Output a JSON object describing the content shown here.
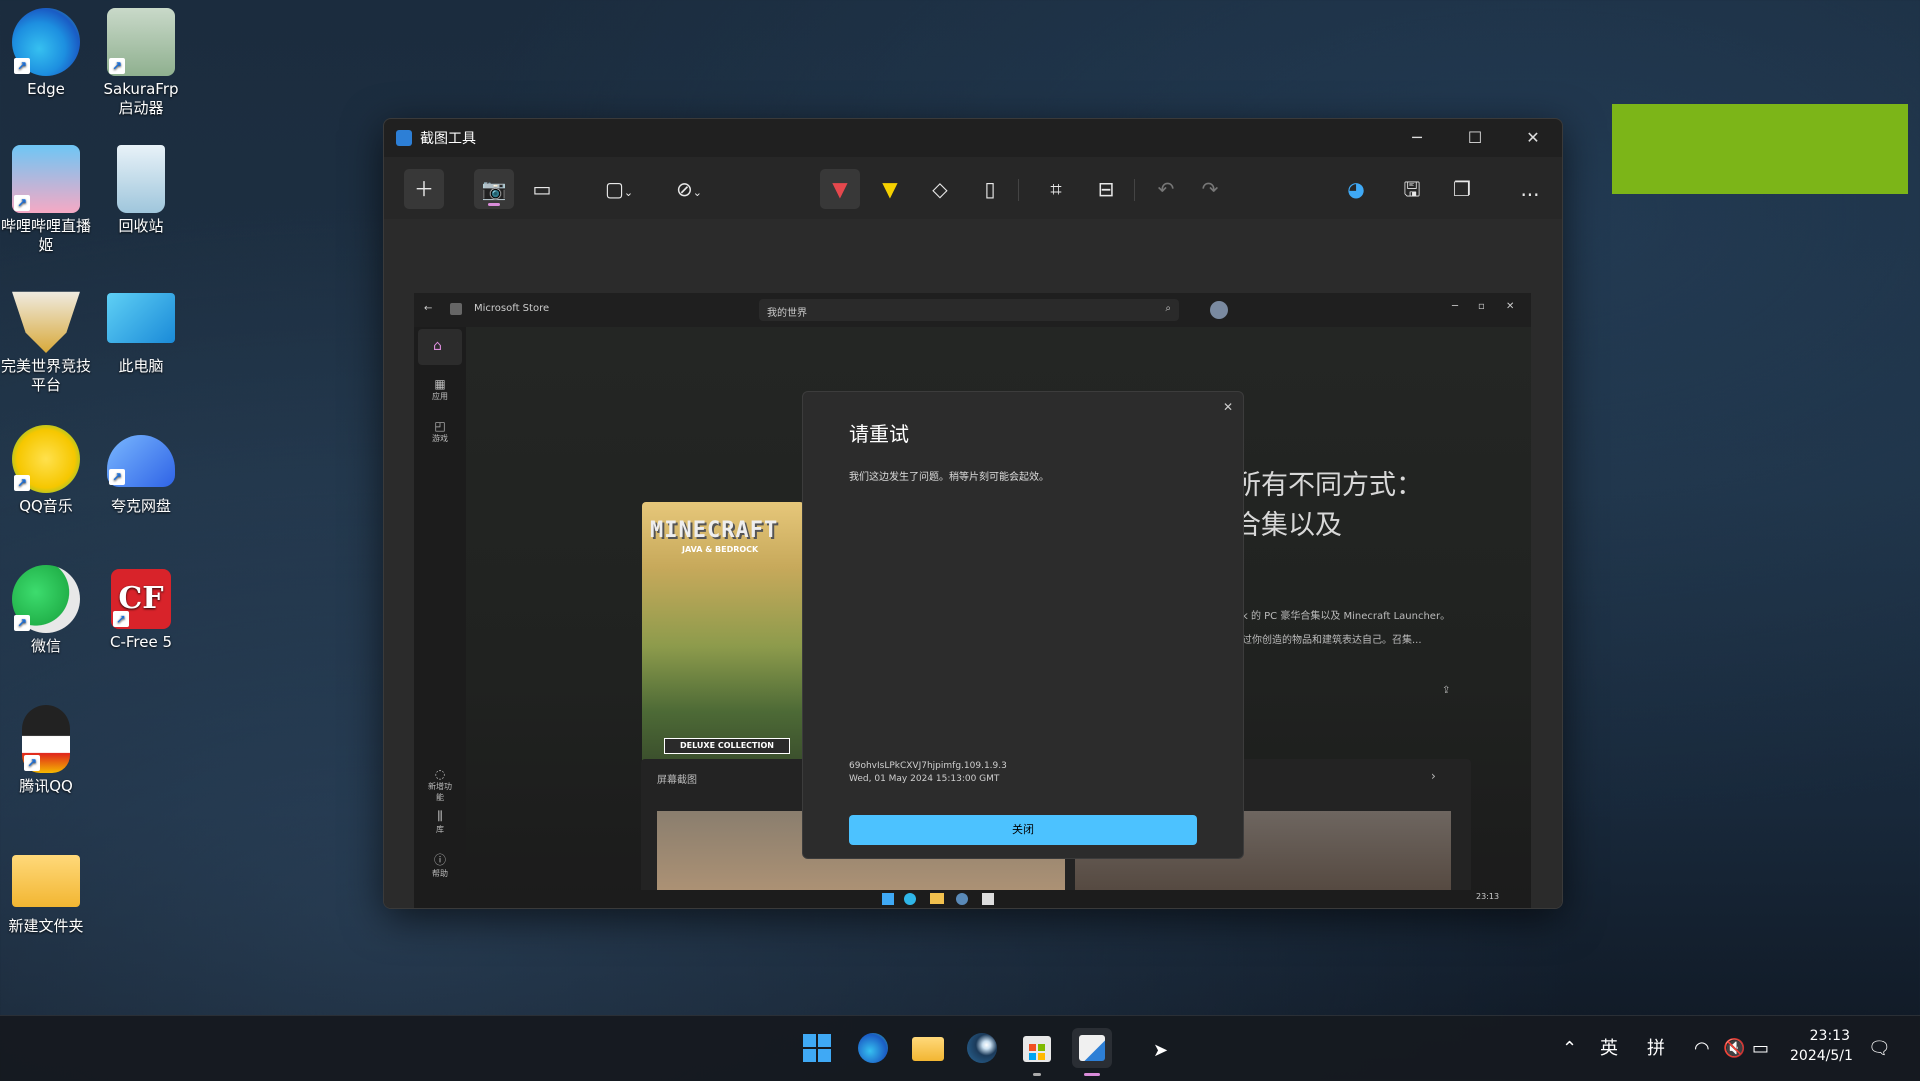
{
  "desktop": {
    "icons": [
      {
        "label": "Edge"
      },
      {
        "label": "SakuraFrp 启动器"
      },
      {
        "label": "哔哩哔哩直播姬"
      },
      {
        "label": "回收站"
      },
      {
        "label": "完美世界竞技平台"
      },
      {
        "label": "此电脑"
      },
      {
        "label": "QQ音乐"
      },
      {
        "label": "夸克网盘"
      },
      {
        "label": "微信"
      },
      {
        "label": "C-Free 5"
      },
      {
        "label": "腾讯QQ"
      },
      {
        "label": "新建文件夹"
      }
    ]
  },
  "snip_window": {
    "title": "截图工具",
    "toolbar_icons": [
      "plus-icon",
      "camera-icon",
      "video-icon",
      "rectangle-mode-icon",
      "timer-off-icon",
      "ballpoint-pen-icon",
      "highlighter-icon",
      "eraser-icon",
      "ruler-icon",
      "crop-icon",
      "text-actions-icon",
      "undo-icon",
      "redo-icon",
      "paint-icon",
      "save-icon",
      "copy-icon",
      "more-icon"
    ],
    "more_label": "..."
  },
  "store": {
    "app_name": "Microsoft Store",
    "search_value": "我的世界",
    "sidebar": {
      "apps_label": "应用",
      "games_label": "游戏",
      "whatsnew_label": "新增功能",
      "library_label": "库",
      "help_label": "帮助"
    },
    "hero_line1": "所有不同方式：",
    "hero_line2": "合集以及",
    "desc_line1": "k 的 PC 豪华合集以及 Minecraft Launcher。",
    "desc_line2": "过你创造的物品和建筑表达自己。召集...",
    "cover": {
      "logo": "MINECRAFT",
      "sub": "JAVA & BEDROCK",
      "badge": "DELUXE COLLECTION"
    },
    "screenshots_label": "屏幕截图",
    "dialog": {
      "title": "请重试",
      "message": "我们这边发生了问题。稍等片刻可能会起效。",
      "code_line1": "69ohvIsLPkCXVJ7hjpimfg.109.1.9.3",
      "code_line2": "Wed, 01 May 2024 15:13:00 GMT",
      "close_button": "关闭"
    },
    "tray_time": "23:13"
  },
  "taskbar": {
    "ime_lang": "英",
    "ime_mode": "拼",
    "time": "23:13",
    "date": "2024/5/1"
  },
  "colors": {
    "accent": "#4cc2ff",
    "green_block": "#7cb518",
    "pen_highlight": "#d98cd9"
  }
}
